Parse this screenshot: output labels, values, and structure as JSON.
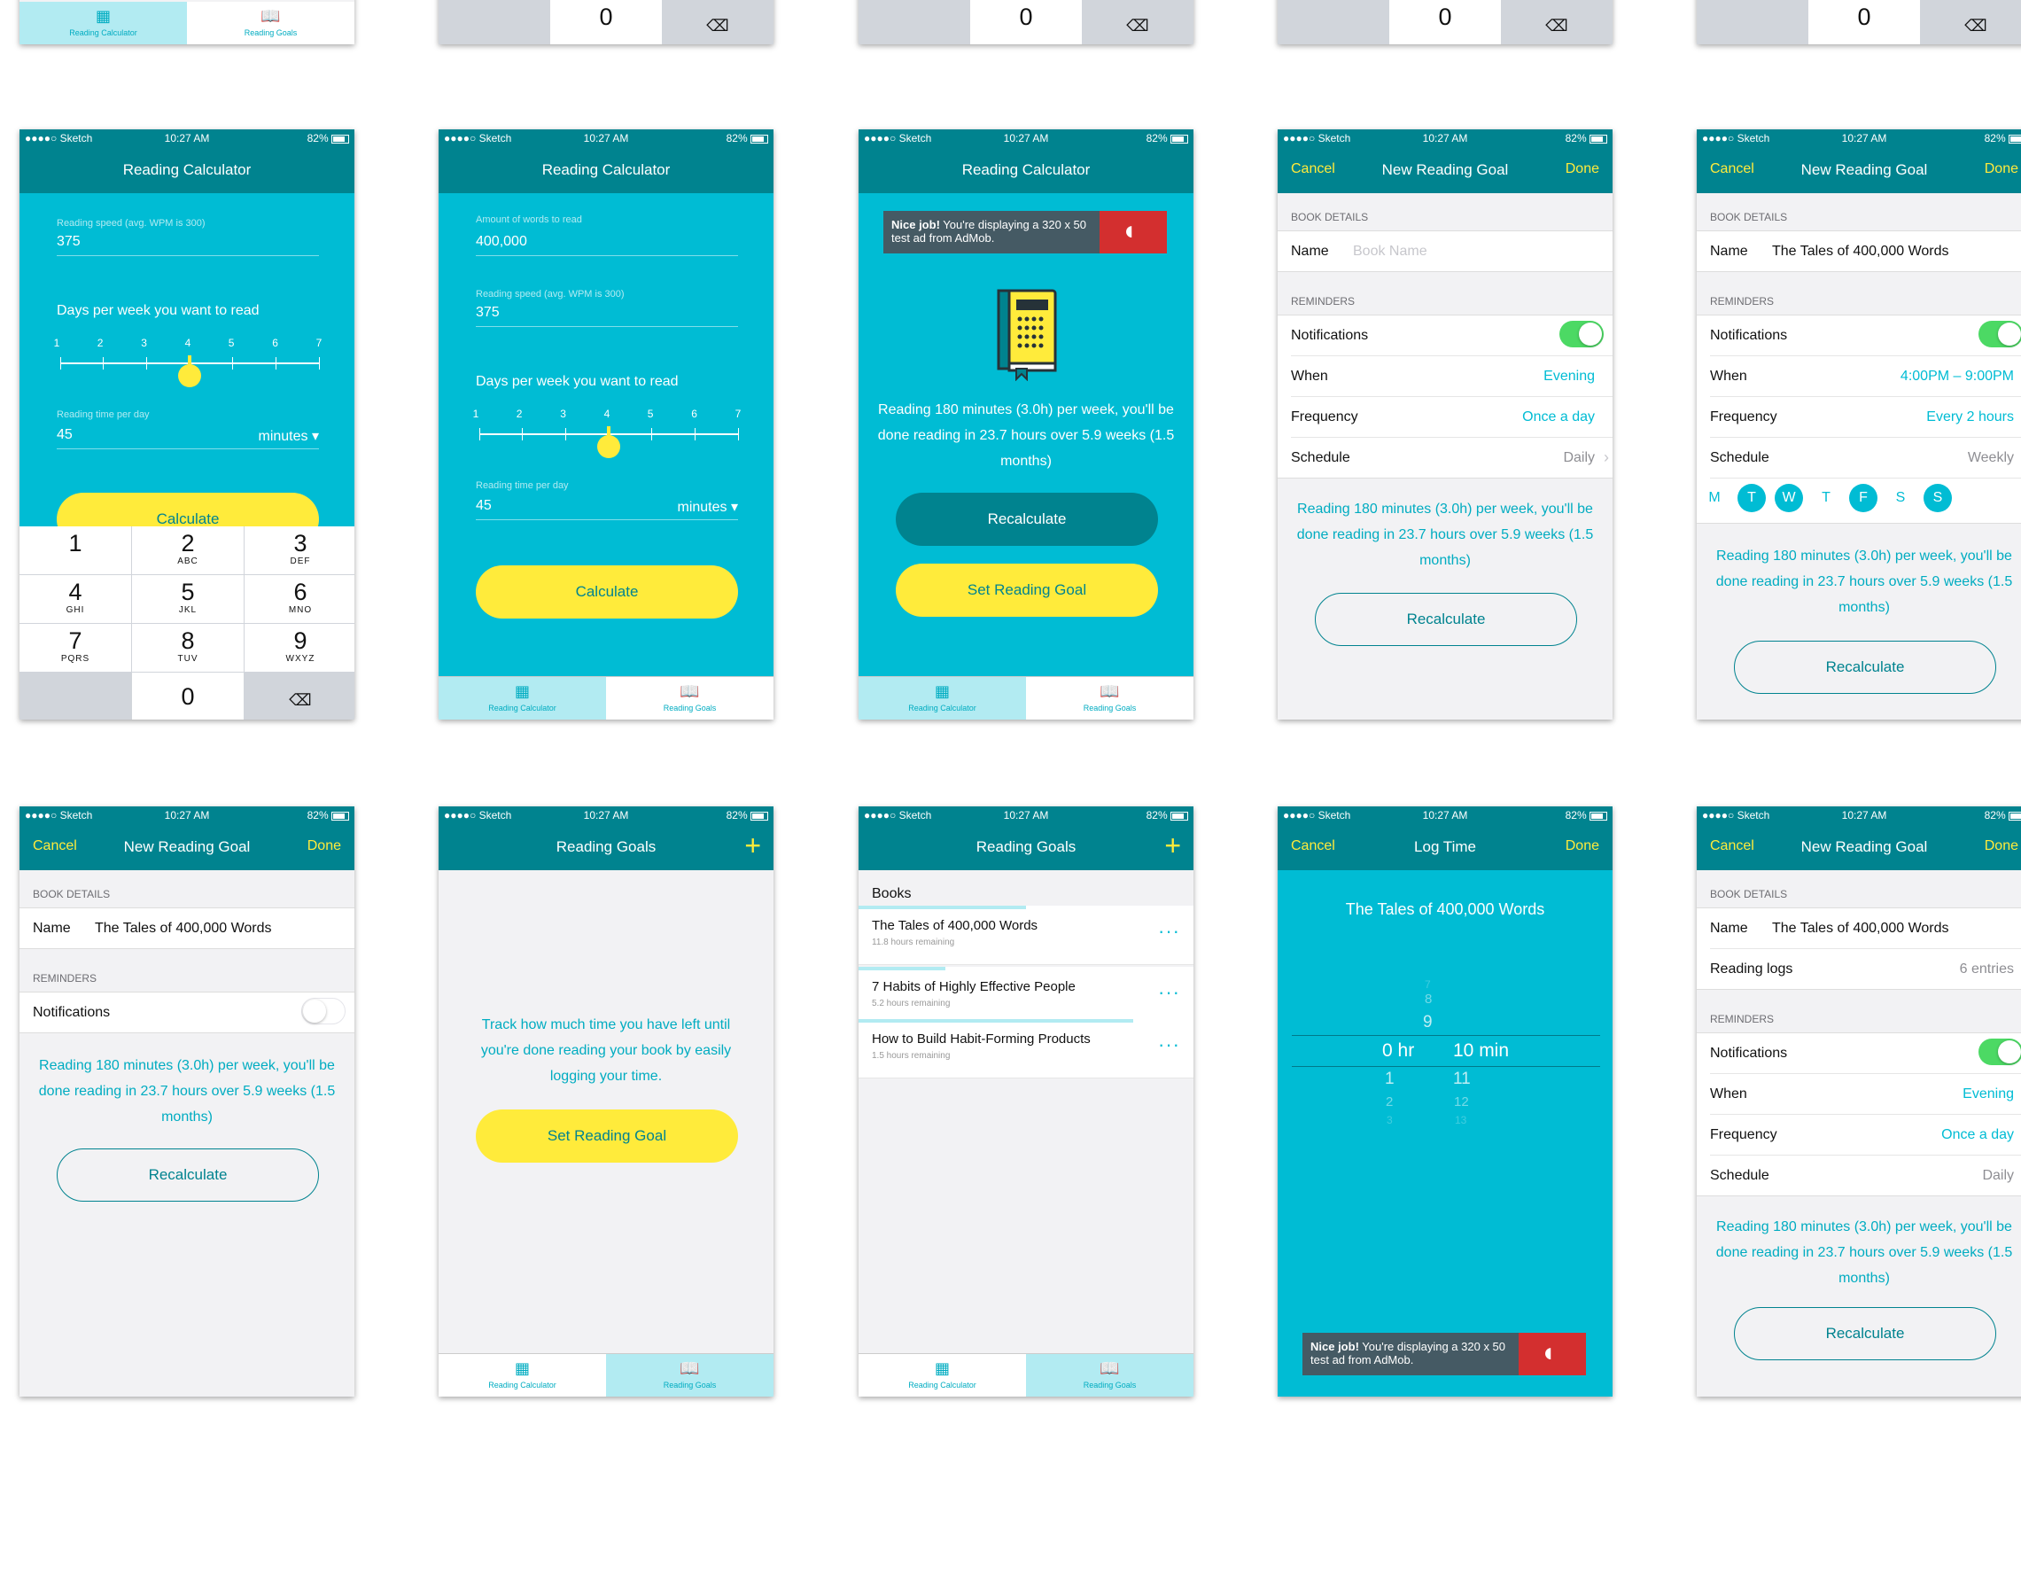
{
  "status": {
    "carrier": "●●●●○ Sketch",
    "time": "10:27 AM",
    "battery": "82%"
  },
  "tabs": {
    "calculator": "Reading Calculator",
    "goals": "Reading Goals"
  },
  "keypad": {
    "keys": [
      {
        "num": "1",
        "letters": ""
      },
      {
        "num": "2",
        "letters": "ABC"
      },
      {
        "num": "3",
        "letters": "DEF"
      },
      {
        "num": "4",
        "letters": "GHI"
      },
      {
        "num": "5",
        "letters": "JKL"
      },
      {
        "num": "6",
        "letters": "MNO"
      },
      {
        "num": "7",
        "letters": "PQRS"
      },
      {
        "num": "8",
        "letters": "TUV"
      },
      {
        "num": "9",
        "letters": "WXYZ"
      }
    ],
    "zero": "0",
    "delete_icon": "backspace-icon"
  },
  "calc": {
    "title": "Reading Calculator",
    "words_label": "Amount of words to read",
    "words_value": "400,000",
    "speed_label": "Reading speed (avg. WPM is 300)",
    "speed_value": "375",
    "days_label": "Days per week you want to read",
    "days_ticks": [
      "1",
      "2",
      "3",
      "4",
      "5",
      "6",
      "7"
    ],
    "days_selected": 4,
    "time_label": "Reading time per day",
    "time_value": "45",
    "time_unit": "minutes ▾",
    "calculate": "Calculate"
  },
  "result": {
    "ad_bold": "Nice job!",
    "ad_text": " You're displaying a 320 x 50 test ad from AdMob.",
    "message": "Reading 180 minutes (3.0h) per week, you'll be done reading in 23.7 hours over 5.9 weeks (1.5 months)",
    "recalculate": "Recalculate",
    "set_goal": "Set Reading Goal"
  },
  "goal_form": {
    "cancel": "Cancel",
    "title": "New Reading Goal",
    "done": "Done",
    "book_section": "BOOK DETAILS",
    "name_label": "Name",
    "name_placeholder": "Book Name",
    "name_value": "The Tales of 400,000 Words",
    "reminders_section": "REMINDERS",
    "notifications": "Notifications",
    "when": "When",
    "frequency": "Frequency",
    "schedule": "Schedule",
    "when_evening": "Evening",
    "when_range": "4:00PM – 9:00PM",
    "freq_once": "Once a day",
    "freq_every2": "Every 2 hours",
    "sched_daily": "Daily",
    "sched_weekly": "Weekly",
    "weekdays": [
      {
        "label": "M",
        "on": false
      },
      {
        "label": "T",
        "on": true
      },
      {
        "label": "W",
        "on": true
      },
      {
        "label": "T",
        "on": false
      },
      {
        "label": "F",
        "on": true
      },
      {
        "label": "S",
        "on": false
      },
      {
        "label": "S",
        "on": true
      }
    ],
    "message": "Reading 180 minutes (3.0h) per week, you'll be done reading in 23.7 hours over 5.9 weeks (1.5 months)",
    "recalculate": "Recalculate",
    "reading_logs": "Reading logs",
    "reading_logs_value": "6 entries"
  },
  "goals": {
    "title": "Reading Goals",
    "empty_message": "Track how much time you have left until you're done reading your book by easily logging your time.",
    "set_goal": "Set Reading Goal",
    "list_header": "Books",
    "books": [
      {
        "title": "The Tales of 400,000 Words",
        "sub": "11.8 hours remaining",
        "progress": 0.5
      },
      {
        "title": "7 Habits of Highly Effective People",
        "sub": "5.2 hours remaining",
        "progress": 0.26
      },
      {
        "title": "How to Build Habit-Forming Products",
        "sub": "1.5 hours remaining",
        "progress": 0.82
      }
    ]
  },
  "log": {
    "cancel": "Cancel",
    "title": "Log Time",
    "done": "Done",
    "book": "The Tales of 400,000 Words",
    "hours_selected": "0 hr",
    "minutes_selected": "10 min",
    "hours_below": [
      "1",
      "2",
      "3"
    ],
    "minutes_above": [
      "7",
      "8",
      "9"
    ],
    "minutes_below": [
      "11",
      "12",
      "13"
    ]
  }
}
